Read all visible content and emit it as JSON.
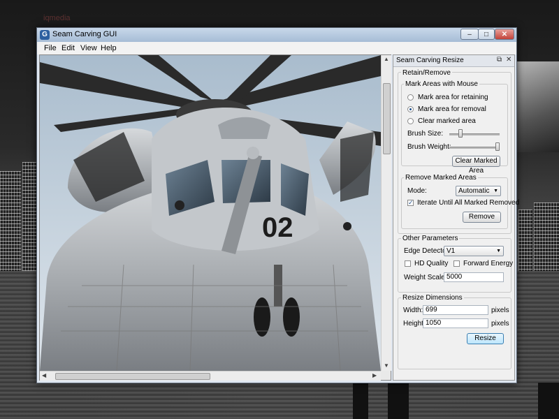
{
  "watermark": "iqmedia",
  "window": {
    "title": "Seam Carving GUI",
    "app_icon_letter": "G",
    "min_glyph": "–",
    "max_glyph": "□",
    "close_glyph": "✕"
  },
  "menu": {
    "file": "File",
    "edit": "Edit",
    "view": "View",
    "help": "Help"
  },
  "image": {
    "tail_number": "02"
  },
  "panel": {
    "title": "Seam Carving Resize",
    "float_glyph": "⧉",
    "close_glyph": "✕",
    "retain_remove": {
      "label": "Retain/Remove",
      "mark_group_label": "Mark Areas with Mouse",
      "options": [
        "Mark area for retaining",
        "Mark area for removal",
        "Clear marked area"
      ],
      "selected_index": 1,
      "brush_size_label": "Brush Size:",
      "brush_size_level": 0.2,
      "brush_weight_label": "Brush Weight:",
      "brush_weight_level": 1.0,
      "clear_button": "Clear Marked Area"
    },
    "remove_marked": {
      "label": "Remove Marked Areas",
      "mode_label": "Mode:",
      "mode_value": "Automatic",
      "iterate_label": "Iterate Until All Marked Removed",
      "iterate_checked": true,
      "remove_button": "Remove"
    },
    "other_params": {
      "label": "Other Parameters",
      "edge_detector_label": "Edge Detector:",
      "edge_detector_value": "V1",
      "hd_quality_label": "HD Quality",
      "hd_quality_checked": false,
      "forward_energy_label": "Forward Energy",
      "forward_energy_checked": false,
      "weight_scale_label": "Weight Scale:",
      "weight_scale_value": "5000"
    },
    "resize_dims": {
      "label": "Resize Dimensions",
      "width_label": "Width:",
      "width_value": "699",
      "height_label": "Height:",
      "height_value": "1050",
      "unit": "pixels",
      "resize_button": "Resize"
    }
  }
}
